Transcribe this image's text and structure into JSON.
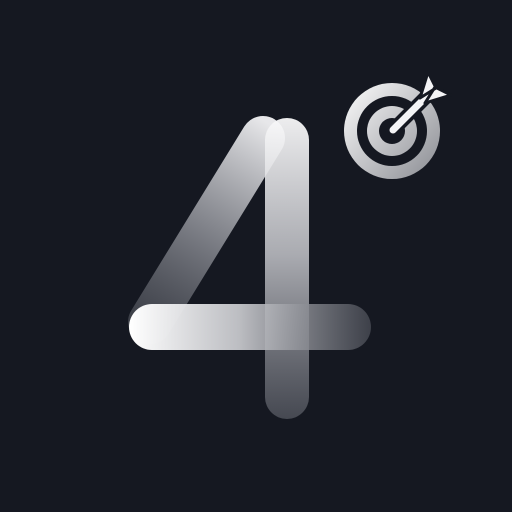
{
  "icon": {
    "name": "app-icon",
    "glyph_name": "number-four-logo",
    "badge_name": "target-arrow-icon"
  },
  "colors": {
    "background": "#151821",
    "stroke_light": "#f4f4f6",
    "stroke_mid": "#a9abb1",
    "stroke_dark": "#50545d",
    "target_outer": "#e8e8ea",
    "target_shade": "#8e9096"
  }
}
